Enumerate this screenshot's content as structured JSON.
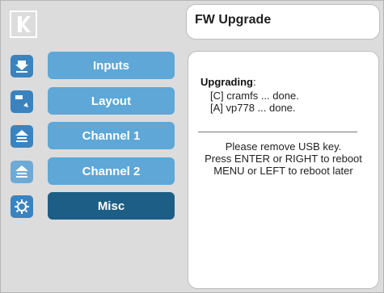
{
  "header": {
    "logo": "kramer-logo",
    "title": "FW Upgrade"
  },
  "menu": [
    {
      "label": "Inputs",
      "icon": "input-icon"
    },
    {
      "label": "Layout",
      "icon": "layout-icon"
    },
    {
      "label": "Channel 1",
      "icon": "channel-1-icon"
    },
    {
      "label": "Channel 2",
      "icon": "channel-2-icon"
    },
    {
      "label": "Misc",
      "icon": "misc-icon",
      "active": true
    }
  ],
  "content": {
    "heading": "Upgrading",
    "heading_suffix": ":",
    "lines": [
      "[C] cramfs ... done.",
      "[A] vp778 ... done."
    ],
    "messages": [
      "Please remove USB key.",
      "Press ENTER or RIGHT to reboot",
      "MENU or LEFT to reboot later"
    ]
  },
  "colors": {
    "background": "#dcdcdc",
    "button": "#5ea7d7",
    "button_active": "#1c5e85",
    "icon_bg": "#3b83bf"
  }
}
